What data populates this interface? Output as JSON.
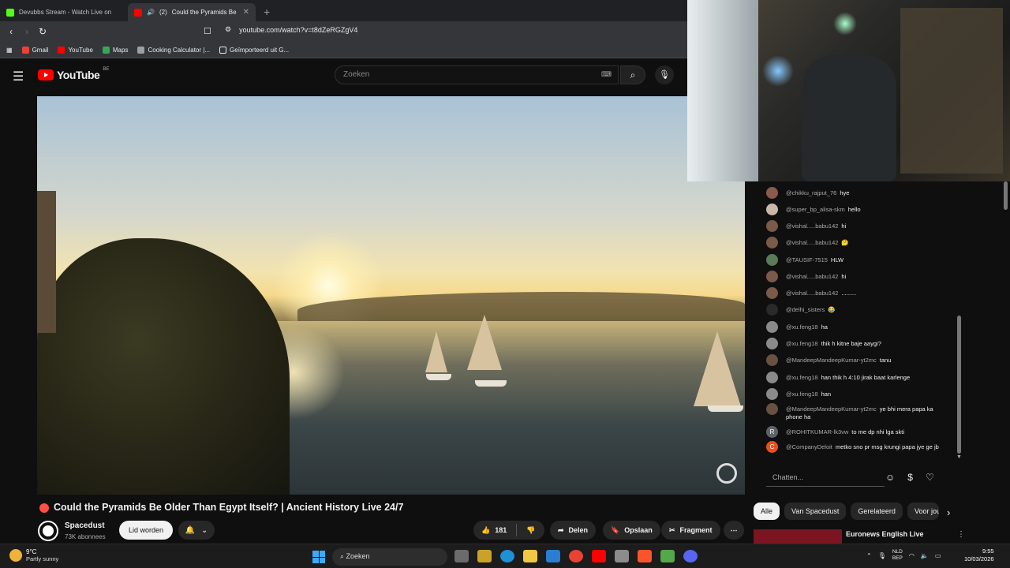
{
  "browser": {
    "tabs": [
      {
        "title": "Devubbs Stream - Watch Live on",
        "favicon_color": "#53fc18",
        "active": false
      },
      {
        "title": "Could the Pyramids Be",
        "prefix": "(2)",
        "favicon_color": "#ff0000",
        "active": true
      }
    ],
    "url": "youtube.com/watch?v=t8dZeRGZgV4",
    "bookmarks": [
      {
        "label": "Gmail",
        "color": "#ea4335"
      },
      {
        "label": "YouTube",
        "color": "#ff0000"
      },
      {
        "label": "Maps",
        "color": "#34a853"
      },
      {
        "label": "Cooking Calculator |...",
        "color": "#9aa0a6"
      },
      {
        "label": "Geïmporteerd uit G...",
        "color": "#e8eaed"
      }
    ]
  },
  "youtube": {
    "logo_text": "YouTube",
    "country_code": "BE",
    "search_placeholder": "Zoeken"
  },
  "video": {
    "title": "Could the Pyramids Be Older Than Egypt Itself? | Ancient History Live 24/7",
    "channel": "Spacedust",
    "subscribers": "73K abonnees",
    "join_label": "Lid worden",
    "likes": "181",
    "share_label": "Delen",
    "save_label": "Opslaan",
    "clip_label": "Fragment"
  },
  "chat": {
    "messages": [
      {
        "user": "@chikku_rajput_76",
        "text": "hye",
        "avatar_color": "#8a5a4a"
      },
      {
        "user": "@super_bp_alisa-skm",
        "text": "hello",
        "avatar_color": "#c9b7a8"
      },
      {
        "user": "@vishal.....babu142",
        "text": "hi",
        "avatar_color": "#7a5a48"
      },
      {
        "user": "@vishal.....babu142",
        "text": "🤔",
        "avatar_color": "#7a5a48"
      },
      {
        "user": "@TAUSIF-7515",
        "text": "HLW",
        "avatar_color": "#5a7a5a"
      },
      {
        "user": "@vishal.....babu142",
        "text": "hi",
        "avatar_color": "#7a5a48"
      },
      {
        "user": "@vishal.....babu142",
        "text": ".........",
        "avatar_color": "#7a5a48"
      },
      {
        "user": "@delhi_sisters",
        "text": "😂",
        "avatar_color": "#2a2a2a"
      },
      {
        "user": "@xu.feng18",
        "text": "ha",
        "avatar_color": "#8a8a8a"
      },
      {
        "user": "@xu.feng18",
        "text": "thik h kitne baje aaygi?",
        "avatar_color": "#8a8a8a"
      },
      {
        "user": "@MandeepMandeepKumar-yt2mc",
        "text": "tanu",
        "avatar_color": "#6a5040"
      },
      {
        "user": "@xu.feng18",
        "text": "han thik h 4:10 jirak baat karlenge",
        "avatar_color": "#8a8a8a"
      },
      {
        "user": "@xu.feng18",
        "text": "han",
        "avatar_color": "#8a8a8a"
      },
      {
        "user": "@MandeepMandeepKumar-yt2mc",
        "text": "ye bhi mera papa ka phone ha",
        "avatar_color": "#6a5040"
      },
      {
        "user": "@ROHITKUMAR-lk3vw",
        "text": "to me dp nhi lga skti",
        "avatar_color": "#5f6368",
        "initial": "R"
      },
      {
        "user": "@CompanyDeloit",
        "text": "metko sno pr msg krungi papa jye ge jb",
        "avatar_color": "#e8511f",
        "initial": "C"
      }
    ],
    "input_placeholder": "Chatten..."
  },
  "filters": [
    "Alle",
    "Van Spacedust",
    "Gerelateerd",
    "Voor jou"
  ],
  "recommendation": {
    "title": "Euronews English Live"
  },
  "taskbar": {
    "temp": "9°C",
    "weather": "Partly sunny",
    "search_label": "Zoeken",
    "lang_top": "NLD",
    "lang_bottom": "BEP",
    "time": "9:55",
    "date": "10/03/2026",
    "app_colors": [
      "#6b6b6b",
      "#c9a227",
      "#1f8fd6",
      "#f2c744",
      "#2b7cd3",
      "#ea4335",
      "#ff0000",
      "#8c8c8c",
      "#fb542b",
      "#55a84a",
      "#5865f2"
    ]
  }
}
